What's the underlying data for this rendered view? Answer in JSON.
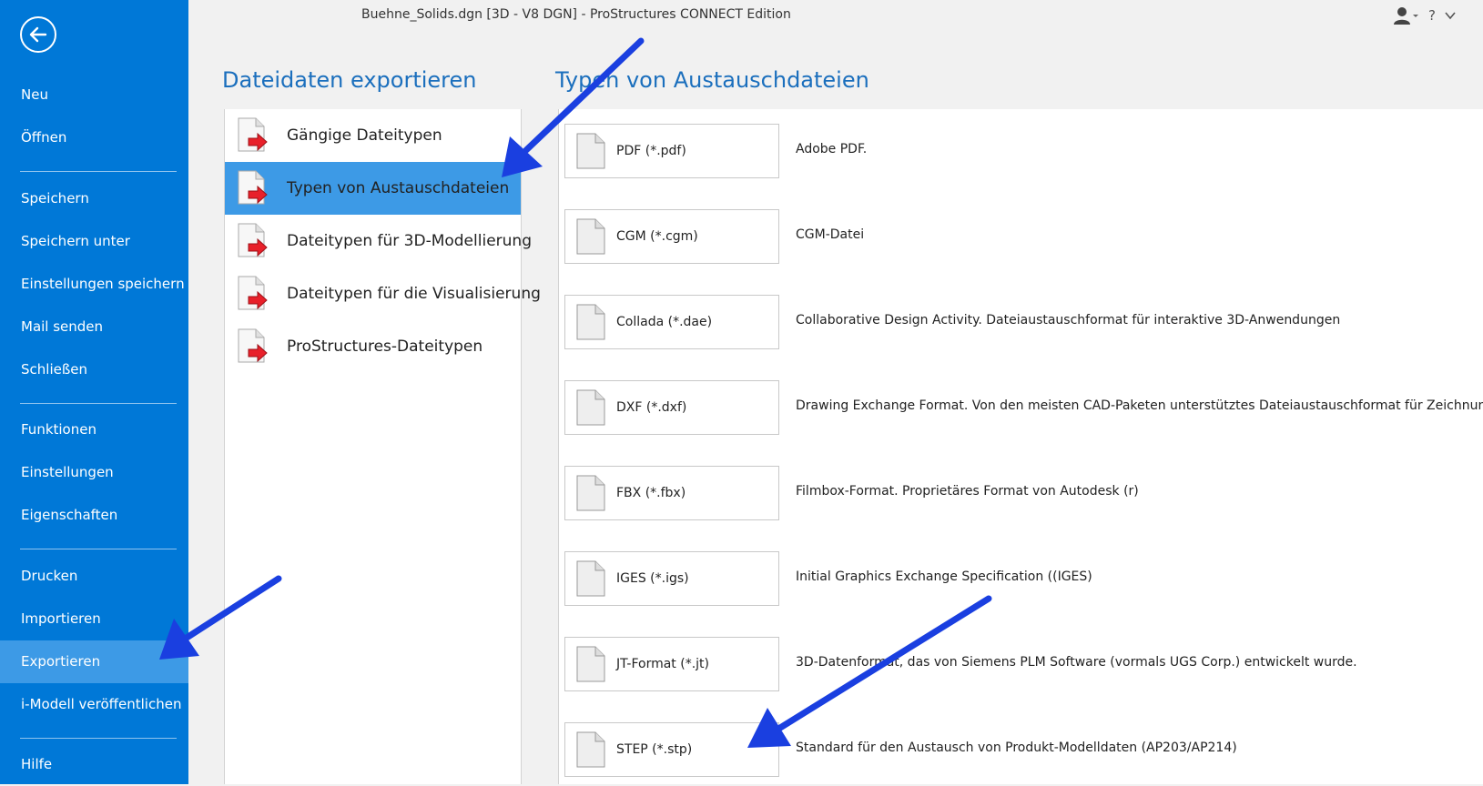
{
  "window": {
    "title": "Buehne_Solids.dgn [3D - V8 DGN] - ProStructures CONNECT Edition",
    "help_label": "?"
  },
  "nav": {
    "back_icon": "back-arrow-icon",
    "items": [
      {
        "label": "Neu"
      },
      {
        "label": "Öffnen"
      },
      {
        "label": "Speichern"
      },
      {
        "label": "Speichern unter"
      },
      {
        "label": "Einstellungen speichern"
      },
      {
        "label": "Mail senden"
      },
      {
        "label": "Schließen"
      },
      {
        "label": "Funktionen"
      },
      {
        "label": "Einstellungen"
      },
      {
        "label": "Eigenschaften"
      },
      {
        "label": "Drucken"
      },
      {
        "label": "Importieren"
      },
      {
        "label": "Exportieren",
        "active": true
      },
      {
        "label": "i-Modell veröffentlichen"
      },
      {
        "label": "Hilfe"
      }
    ]
  },
  "export": {
    "heading": "Dateidaten exportieren",
    "categories": [
      {
        "label": "Gängige Dateitypen"
      },
      {
        "label": "Typen von Austauschdateien",
        "active": true
      },
      {
        "label": "Dateitypen für 3D-Modellierung"
      },
      {
        "label": "Dateitypen für die Visualisierung"
      },
      {
        "label": "ProStructures-Dateitypen"
      }
    ]
  },
  "types": {
    "heading": "Typen von Austauschdateien",
    "items": [
      {
        "label": "PDF (*.pdf)",
        "desc": "Adobe PDF."
      },
      {
        "label": "CGM (*.cgm)",
        "desc": "CGM-Datei"
      },
      {
        "label": "Collada (*.dae)",
        "desc": "Collaborative Design Activity. Dateiaustauschformat für interaktive 3D-Anwendungen"
      },
      {
        "label": "DXF (*.dxf)",
        "desc": "Drawing Exchange Format. Von den meisten CAD-Paketen unterstütztes Dateiaustauschformat für Zeichnungen"
      },
      {
        "label": "FBX (*.fbx)",
        "desc": "Filmbox-Format. Proprietäres Format von Autodesk (r)"
      },
      {
        "label": "IGES (*.igs)",
        "desc": "Initial Graphics Exchange Specification ((IGES)"
      },
      {
        "label": "JT-Format (*.jt)",
        "desc": "3D-Datenformat, das von Siemens PLM Software (vormals UGS Corp.) entwickelt wurde."
      },
      {
        "label": "STEP (*.stp)",
        "desc": "Standard für den Austausch von Produkt-Modelldaten (AP203/AP214)"
      }
    ]
  },
  "colors": {
    "nav_bg": "#0078d7",
    "nav_active": "#3d9ae6",
    "heading": "#1b6fbd",
    "annotation_arrow": "#1a3fe0",
    "export_icon_arrow": "#e8202a"
  }
}
